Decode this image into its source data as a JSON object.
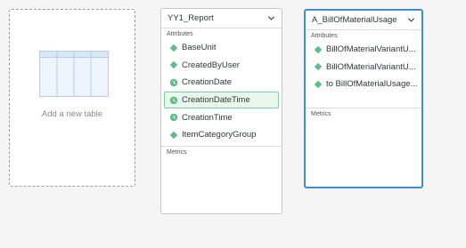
{
  "add_table": {
    "label": "Add a new table"
  },
  "tables": [
    {
      "title": "YY1_Report",
      "attributes_label": "Attributes",
      "metrics_label": "Metrics",
      "attributes": [
        {
          "label": "BaseUnit",
          "icon": "dimension-icon"
        },
        {
          "label": "CreatedByUser",
          "icon": "dimension-icon"
        },
        {
          "label": "CreationDate",
          "icon": "time-icon"
        },
        {
          "label": "CreationDateTime",
          "icon": "time-icon"
        },
        {
          "label": "CreationTime",
          "icon": "time-icon"
        },
        {
          "label": "ItemCategoryGroup",
          "icon": "dimension-icon"
        }
      ]
    },
    {
      "title": "A_BillOfMaterialUsage",
      "attributes_label": "Attributes",
      "metrics_label": "Metrics",
      "attributes": [
        {
          "label": "BillOfMaterialVariantU...",
          "icon": "dimension-icon"
        },
        {
          "label": "BillOfMaterialVariantU...",
          "icon": "dimension-icon"
        },
        {
          "label": "to BillOfMaterialUsage...",
          "icon": "association-icon"
        }
      ]
    }
  ],
  "colors": {
    "dimension_icon": "#5cbf8a",
    "time_icon": "#5cbf8a",
    "highlight_bg": "#e9f7ee",
    "highlight_border": "#7fd0a1",
    "selected_border": "#3a8fd6"
  }
}
